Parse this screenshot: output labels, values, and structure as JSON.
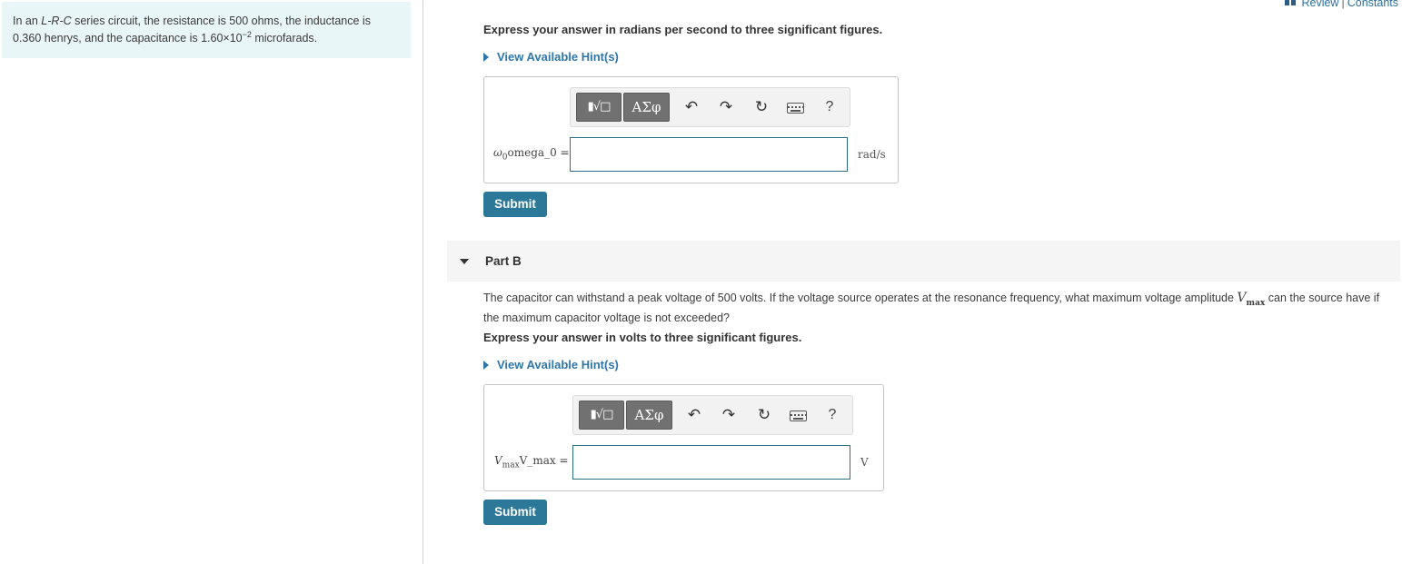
{
  "problem": {
    "text_before": "In an ",
    "circuit_type": "L-R-C",
    "text_mid": " series circuit, the resistance is 500 ohms, the inductance is 0.360 henrys, and the capacitance is 1.60×10",
    "exponent": "−2",
    "text_after": " microfarads."
  },
  "top_links": {
    "review": "Review",
    "separator": "|",
    "constants": "Constants"
  },
  "part_a": {
    "instruction": "Express your answer in radians per second to three significant figures.",
    "hint_label": "View Available Hint(s)",
    "toolbar": {
      "templates": "▮√□",
      "symbols": "ΑΣφ",
      "help": "?"
    },
    "variable_symbol": "ω",
    "variable_sub": "0",
    "variable_text": "omega_0 =",
    "input_value": "",
    "unit": "rad/s",
    "submit_label": "Submit"
  },
  "part_b": {
    "title": "Part B",
    "question_before": "The capacitor can withstand a peak voltage of 500 volts. If the voltage source operates at the resonance frequency, what maximum voltage amplitude ",
    "question_var": "V",
    "question_var_sub": "max",
    "question_after": " can the source have if the maximum capacitor voltage is not exceeded?",
    "instruction": "Express your answer in volts to three significant figures.",
    "hint_label": "View Available Hint(s)",
    "toolbar": {
      "templates": "▮√□",
      "symbols": "ΑΣφ",
      "help": "?"
    },
    "variable_symbol": "V",
    "variable_sub": "max",
    "variable_text": "V_max =",
    "input_value": "",
    "unit": "V",
    "submit_label": "Submit"
  }
}
